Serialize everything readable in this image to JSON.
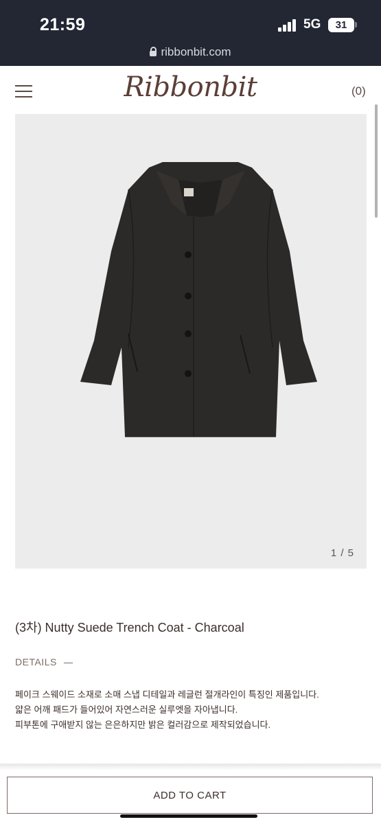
{
  "status_bar": {
    "time": "21:59",
    "network": "5G",
    "battery": "31",
    "url": "ribbonbit.com"
  },
  "header": {
    "logo": "Ribbonbit",
    "cart_count": "(0)"
  },
  "gallery": {
    "counter": "1 / 5"
  },
  "product": {
    "title": "(3차) Nutty Suede Trench Coat - Charcoal",
    "details_label": "DETAILS",
    "description": [
      "페이크 스웨이드 소재로 소매 스냅 디테일과 레글런 절개라인이 특징인 제품입니다.",
      "얇은 어깨 패드가 들어있어 자연스러운 실루엣을 자아냅니다.",
      "피부톤에 구애받지 않는 은은하지만 밝은 컬러감으로 제작되었습니다."
    ]
  },
  "actions": {
    "add_to_cart": "ADD TO CART"
  },
  "colors": {
    "status_bar_bg": "#222733",
    "brand_brown": "#5b3e37",
    "coat_charcoal": "#2c2a28",
    "image_bg": "#ececec"
  },
  "icons": [
    "lock-icon",
    "signal-icon",
    "battery-icon",
    "hamburger-menu-icon"
  ]
}
